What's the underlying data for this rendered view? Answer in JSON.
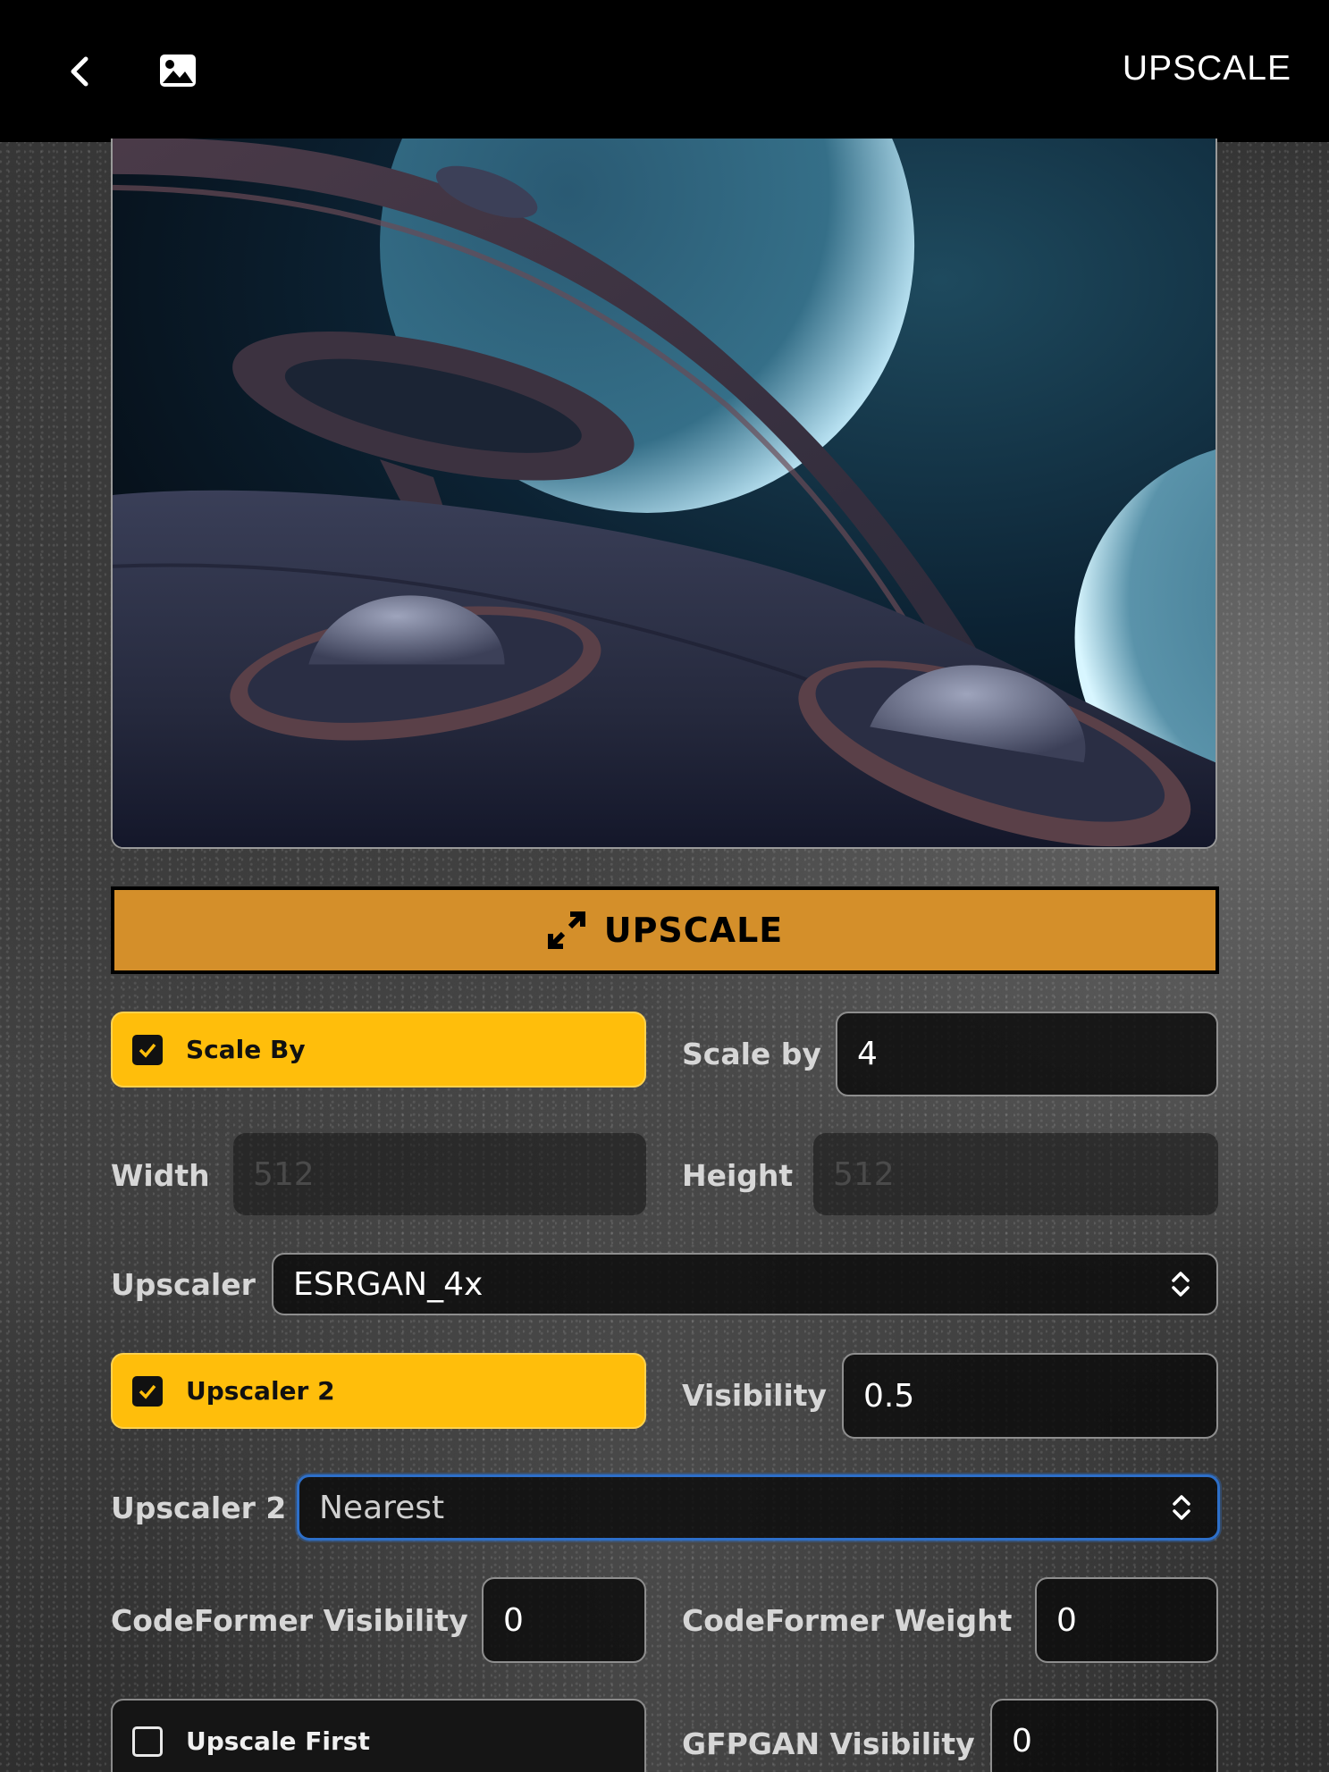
{
  "header": {
    "title": "UPSCALE",
    "back_icon": "chevron-left-icon",
    "gallery_icon": "image-icon"
  },
  "preview": {
    "content": "sci-fi moonscape with flying saucers and ringed planets"
  },
  "actions": {
    "upscale_label": "UPSCALE",
    "upscale_icon": "expand-arrows-icon",
    "accent_color": "#d48f2a"
  },
  "form": {
    "scale_by_toggle": {
      "label": "Scale By",
      "checked": true
    },
    "scale_by": {
      "label": "Scale by",
      "value": "4"
    },
    "width": {
      "label": "Width",
      "placeholder": "512"
    },
    "height": {
      "label": "Height",
      "placeholder": "512"
    },
    "upscaler": {
      "label": "Upscaler",
      "value": "ESRGAN_4x"
    },
    "upscaler2_toggle": {
      "label": "Upscaler 2",
      "checked": true
    },
    "visibility": {
      "label": "Visibility",
      "value": "0.5"
    },
    "upscaler2": {
      "label": "Upscaler 2",
      "value": "Nearest"
    },
    "codeformer_visibility": {
      "label": "CodeFormer Visibility",
      "value": "0"
    },
    "codeformer_weight": {
      "label": "CodeFormer Weight",
      "value": "0"
    },
    "upscale_first": {
      "label": "Upscale First",
      "checked": false
    },
    "gfpgan_visibility": {
      "label": "GFPGAN Visibility",
      "value": "0"
    }
  },
  "colors": {
    "toggle_on": "#ffbe0b",
    "focus_ring": "#2d6fc9"
  }
}
